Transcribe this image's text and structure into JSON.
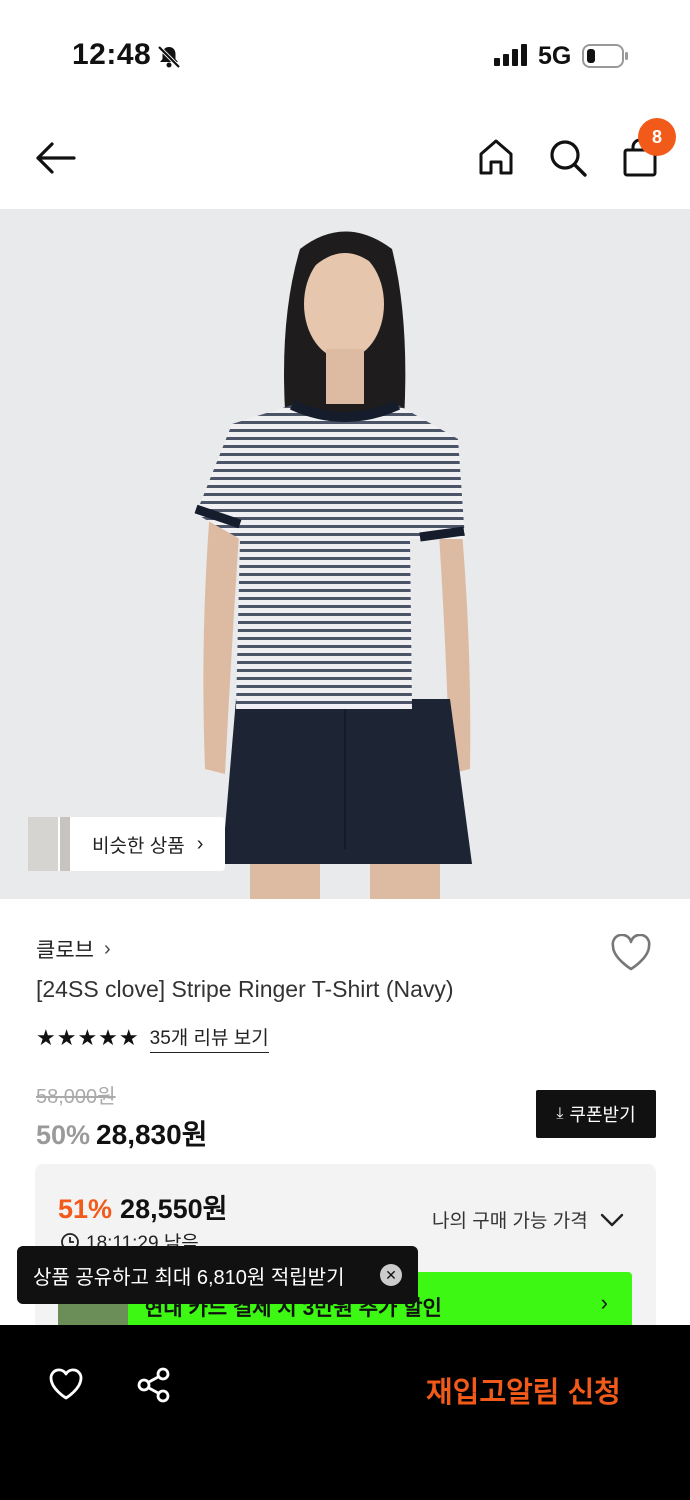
{
  "status_bar": {
    "time": "12:48",
    "network": "5G"
  },
  "header": {
    "cart_count": "8"
  },
  "hero": {
    "similar_label": "비슷한 상품"
  },
  "product": {
    "brand": "클로브",
    "title": "[24SS clove] Stripe Ringer T-Shirt (Navy)",
    "stars": "★★★★★",
    "rating": 5,
    "review_link": "35개 리뷰 보기",
    "original_price": "58,000원",
    "discount": "50%",
    "price": "28,830원",
    "coupon_label": "쿠폰받기"
  },
  "my_price": {
    "discount": "51%",
    "price": "28,550원",
    "link_label": "나의 구매 가능 가격",
    "timer": "18:11:29 남음",
    "promo_text": "현대 카드 결제 시 3만원 추가 할인"
  },
  "toast": {
    "text": "상품 공유하고 최대 6,810원 적립받기"
  },
  "bottom_bar": {
    "restock_label": "재입고알림 신청"
  },
  "colors": {
    "accent": "#f25a1a",
    "promo": "#3cf812",
    "dark": "#111111"
  }
}
